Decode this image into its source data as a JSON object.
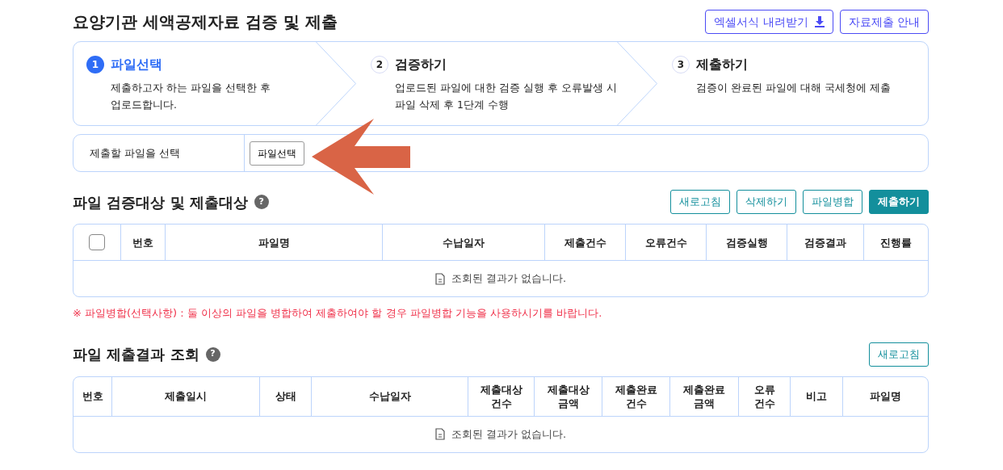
{
  "title": "요양기관 세액공제자료 검증 및 제출",
  "header_buttons": [
    {
      "label": "엑셀서식 내려받기",
      "kind": "download"
    },
    {
      "label": "자료제출 안내",
      "kind": "plain"
    }
  ],
  "steps": [
    {
      "number": "1",
      "title": "파일선택",
      "description_lines": [
        "제출하고자 하는 파일을 선택한 후",
        "업로드합니다."
      ],
      "selected": true
    },
    {
      "number": "2",
      "title": "검증하기",
      "description_lines": [
        "업로드된 파일에 대한 검증 실행 후 오류발생 시",
        "파일 삭제 후 1단계 수행"
      ],
      "selected": false
    },
    {
      "number": "3",
      "title": "제출하기",
      "description_lines": [
        "검증이 완료된 파일에 대해 국세청에 제출"
      ],
      "selected": false
    }
  ],
  "file_select": {
    "label": "제출할 파일을 선택",
    "button": "파일선택"
  },
  "verify_section": {
    "title": "파일 검증대상 및 제출대상",
    "help": "?",
    "buttons": [
      {
        "label": "새로고침",
        "kind": "outline"
      },
      {
        "label": "삭제하기",
        "kind": "outline"
      },
      {
        "label": "파일병합",
        "kind": "outline"
      },
      {
        "label": "제출하기",
        "kind": "filled"
      }
    ],
    "select_all_checked": false,
    "columns": [
      "번호",
      "파일명",
      "수납일자",
      "제출건수",
      "오류건수",
      "검증실행",
      "검증결과",
      "진행률"
    ],
    "empty_message": "조회된 결과가 없습니다."
  },
  "note": "※ 파일병합(선택사항) : 둘 이상의 파일을 병합하여 제출하여야 할 경우 파일병합 기능을 사용하시기를 바랍니다.",
  "result_section": {
    "title": "파일 제출결과 조회",
    "help": "?",
    "buttons": [
      {
        "label": "새로고침",
        "kind": "outline"
      }
    ],
    "columns": [
      "번호",
      "제출일시",
      "상태",
      "수납일자",
      "제출대상 건수",
      "제출대상 금액",
      "제출완료 건수",
      "제출완료 금액",
      "오류 건수",
      "비고",
      "파일명"
    ],
    "empty_message": "조회된 결과가 없습니다."
  }
}
